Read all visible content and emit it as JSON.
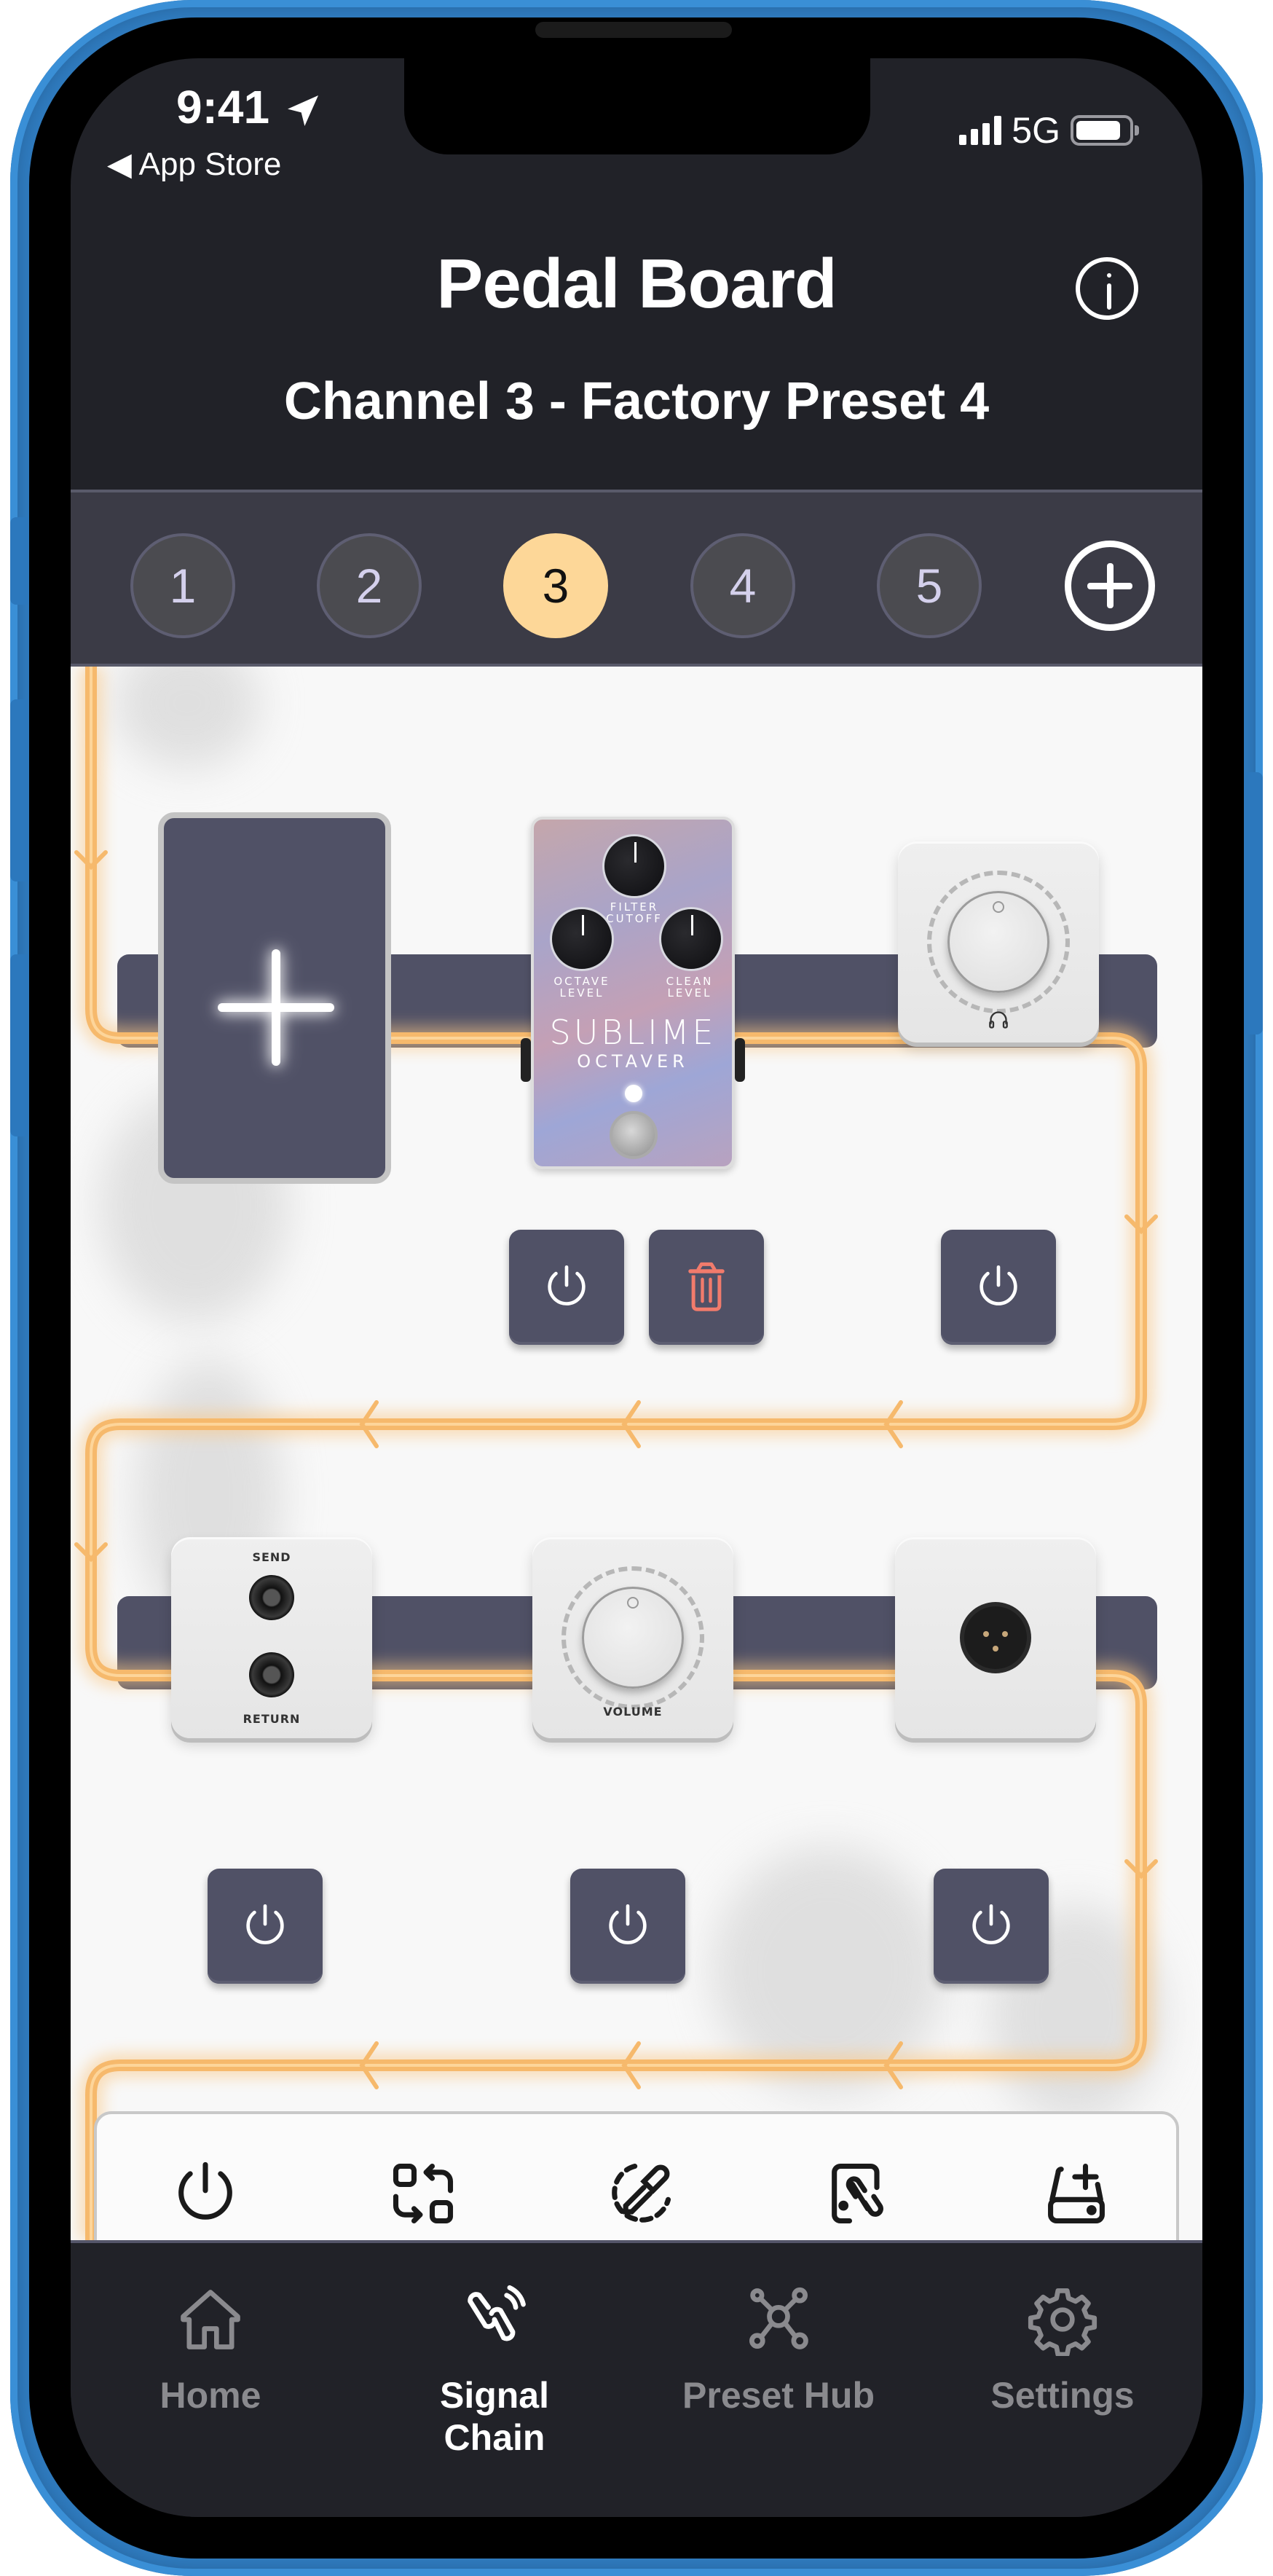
{
  "status_bar": {
    "time": "9:41",
    "back_label": "App Store",
    "network": "5G",
    "location_icon": "location-arrow-icon",
    "signal_icon": "cellular-signal-icon",
    "battery_icon": "battery-icon"
  },
  "header": {
    "title": "Pedal Board",
    "subtitle": "Channel 3 - Factory Preset 4",
    "info_icon": "info-icon"
  },
  "channels": {
    "items": [
      {
        "label": "1",
        "active": false
      },
      {
        "label": "2",
        "active": false
      },
      {
        "label": "3",
        "active": true
      },
      {
        "label": "4",
        "active": false
      },
      {
        "label": "5",
        "active": false
      }
    ],
    "add_icon": "plus-circle-icon",
    "active_color": "#fdd798"
  },
  "board": {
    "row1": {
      "add_slot_icon": "plus-icon",
      "pedal": {
        "brand": "SUBLIME",
        "model": "OCTAVER",
        "knobs": [
          {
            "label_line1": "FILTER",
            "label_line2": "CUTOFF"
          },
          {
            "label_line1": "OCTAVE",
            "label_line2": "LEVEL"
          },
          {
            "label_line1": "CLEAN",
            "label_line2": "LEVEL"
          }
        ]
      },
      "headphone_module_icon": "headphones-icon",
      "controls": [
        {
          "type": "power",
          "icon": "power-icon"
        },
        {
          "type": "delete",
          "icon": "trash-icon"
        },
        {
          "type": "power",
          "icon": "power-icon"
        }
      ]
    },
    "row2": {
      "fx_loop": {
        "send_label": "SEND",
        "return_label": "RETURN"
      },
      "volume": {
        "label": "VOLUME"
      },
      "xlr_icon": "xlr-connector-icon",
      "controls": [
        {
          "type": "power",
          "icon": "power-icon"
        },
        {
          "type": "power",
          "icon": "power-icon"
        },
        {
          "type": "power",
          "icon": "power-icon"
        }
      ]
    },
    "cable_color": "#f6b96c",
    "delete_color": "#f17b6c"
  },
  "toolbar": {
    "items": [
      {
        "name": "power",
        "icon": "power-icon"
      },
      {
        "name": "swap",
        "icon": "swap-icon"
      },
      {
        "name": "color-picker",
        "icon": "eyedropper-icon"
      },
      {
        "name": "link-device",
        "icon": "device-link-icon"
      },
      {
        "name": "add-drive",
        "icon": "drive-add-icon"
      }
    ]
  },
  "tabbar": {
    "items": [
      {
        "label": "Home",
        "icon": "home-icon",
        "active": false
      },
      {
        "label": "Signal Chain",
        "icon": "link-icon",
        "active": true
      },
      {
        "label": "Preset Hub",
        "icon": "hub-icon",
        "active": false
      },
      {
        "label": "Settings",
        "icon": "gear-icon",
        "active": false
      }
    ]
  }
}
